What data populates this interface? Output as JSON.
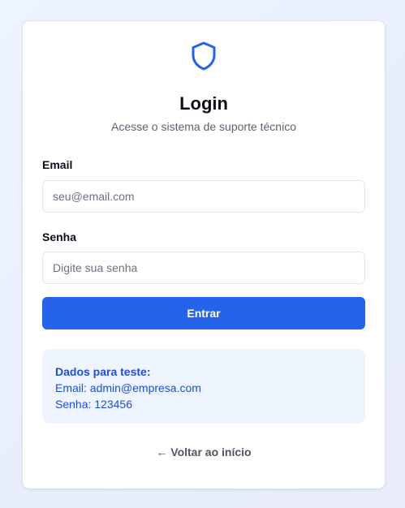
{
  "brand": {
    "icon": "shield-icon",
    "accent_color": "#2563eb"
  },
  "header": {
    "title": "Login",
    "subtitle": "Acesse o sistema de suporte técnico"
  },
  "form": {
    "email_label": "Email",
    "email_placeholder": "seu@email.com",
    "email_value": "",
    "password_label": "Senha",
    "password_placeholder": "Digite sua senha",
    "password_value": "",
    "submit_label": "Entrar"
  },
  "test_credentials": {
    "title": "Dados para teste:",
    "email_line": "Email: admin@empresa.com",
    "password_line": "Senha: 123456"
  },
  "footer": {
    "back_link": "← Voltar ao início"
  }
}
